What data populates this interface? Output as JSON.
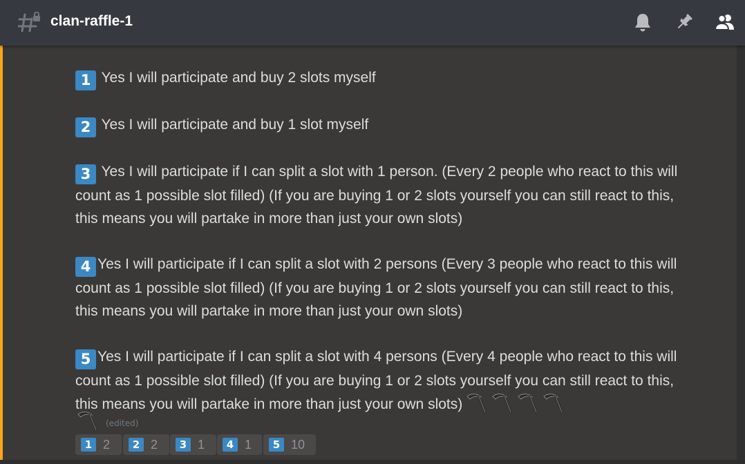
{
  "header": {
    "channel_name": "clan-raffle-1",
    "icons": [
      "locked-hash-channel-icon",
      "notification-bell-icon",
      "pin-icon",
      "member-list-icon"
    ]
  },
  "message": {
    "lines": [
      {
        "key": "1",
        "text": "Yes I will participate and buy 2 slots myself"
      },
      {
        "key": "2",
        "text": "Yes I will participate and buy 1 slot myself"
      },
      {
        "key": "3",
        "text": "Yes I will participate if I can split a slot with 1 person. (Every 2 people who react to this will count as 1 possible slot filled) (If you are buying 1 or 2 slots yourself you can still react to this, this means you will partake in more than just your own slots)"
      },
      {
        "key": "4",
        "text": "Yes I will participate if I can split a slot with 2 persons (Every 3 people who react to this will count as 1 possible slot filled) (If you are buying 1 or 2 slots yourself you can still react to this, this means you will partake in more than just your own slots)"
      },
      {
        "key": "5",
        "text": "Yes I will participate if I can split a slot with 4 persons (Every 4 people who react to this will count as 1 possible slot filled) (If you are buying 1 or 2 slots yourself you can still react to this, this means you will partake in more than just your own slots)"
      }
    ],
    "trailing_emoji": [
      "scythe-emoji-icon",
      "scythe-emoji-icon",
      "scythe-emoji-icon",
      "scythe-emoji-icon",
      "scythe-emoji-icon"
    ],
    "edited_label": "(edited)"
  },
  "reactions": [
    {
      "key": "1",
      "count": "2"
    },
    {
      "key": "2",
      "count": "2"
    },
    {
      "key": "3",
      "count": "1"
    },
    {
      "key": "4",
      "count": "1"
    },
    {
      "key": "5",
      "count": "10"
    }
  ],
  "colors": {
    "background": "#36393f",
    "message_background": "#3a3938",
    "mention_bar": "#faa61a",
    "keycap_blue": "#3b88c3",
    "text": "#dcddde",
    "muted": "#72767d",
    "reaction_bg": "#4a4948"
  }
}
